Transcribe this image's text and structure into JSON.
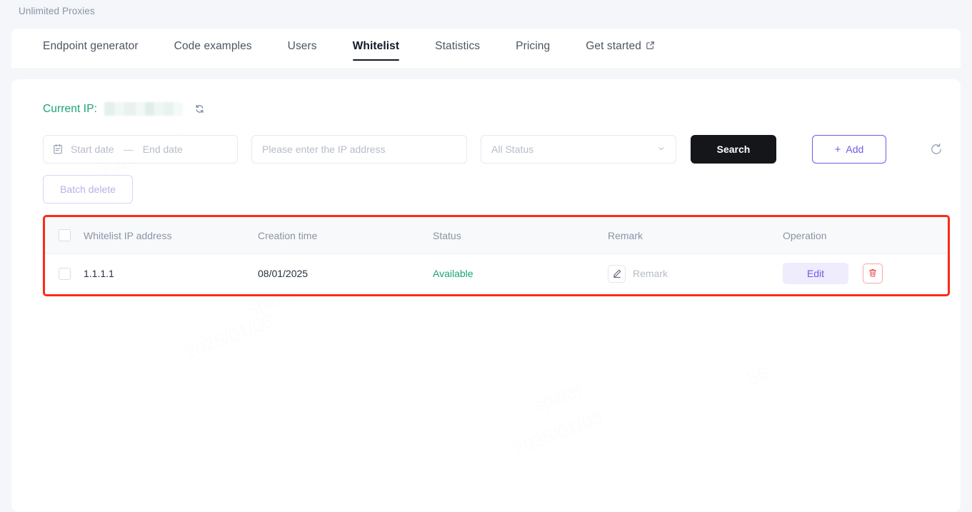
{
  "breadcrumb": "Unlimited Proxies",
  "tabs": [
    {
      "label": "Endpoint generator",
      "active": false,
      "external": false
    },
    {
      "label": "Code examples",
      "active": false,
      "external": false
    },
    {
      "label": "Users",
      "active": false,
      "external": false
    },
    {
      "label": "Whitelist",
      "active": true,
      "external": false
    },
    {
      "label": "Statistics",
      "active": false,
      "external": false
    },
    {
      "label": "Pricing",
      "active": false,
      "external": false
    },
    {
      "label": "Get started",
      "active": false,
      "external": true
    }
  ],
  "current_ip": {
    "label": "Current IP:",
    "value_masked": "",
    "refresh_icon": "refresh-icon",
    "label_color": "#1aa37a"
  },
  "filters": {
    "date_range": {
      "start_placeholder": "Start date",
      "separator": "—",
      "end_placeholder": "End date",
      "icon": "calendar-icon"
    },
    "ip_input": {
      "value": "",
      "placeholder": "Please enter the IP address"
    },
    "status_select": {
      "value": "All Status",
      "icon": "chevron-down-icon"
    },
    "search_label": "Search",
    "add_label": "Add",
    "add_icon": "plus-icon",
    "refresh_icon": "refresh-icon",
    "batch_delete_label": "Batch delete"
  },
  "table": {
    "columns": [
      "Whitelist IP address",
      "Creation time",
      "Status",
      "Remark",
      "Operation"
    ],
    "rows": [
      {
        "ip": "1.1.1.1",
        "creation_time": "08/01/2025",
        "status": "Available",
        "remark_placeholder": "Remark",
        "remark_icon": "pencil-icon",
        "edit_label": "Edit",
        "delete_icon": "trash-icon"
      }
    ]
  },
  "colors": {
    "accent_purple": "#6c5ce7",
    "status_green": "#1aa37a",
    "highlight_red": "#fc2a18",
    "search_black": "#15161a"
  },
  "watermark_text": [
    "2025/01/08",
    "spider",
    "2025/01/08",
    "56",
    "spider",
    "2025/01/08"
  ]
}
